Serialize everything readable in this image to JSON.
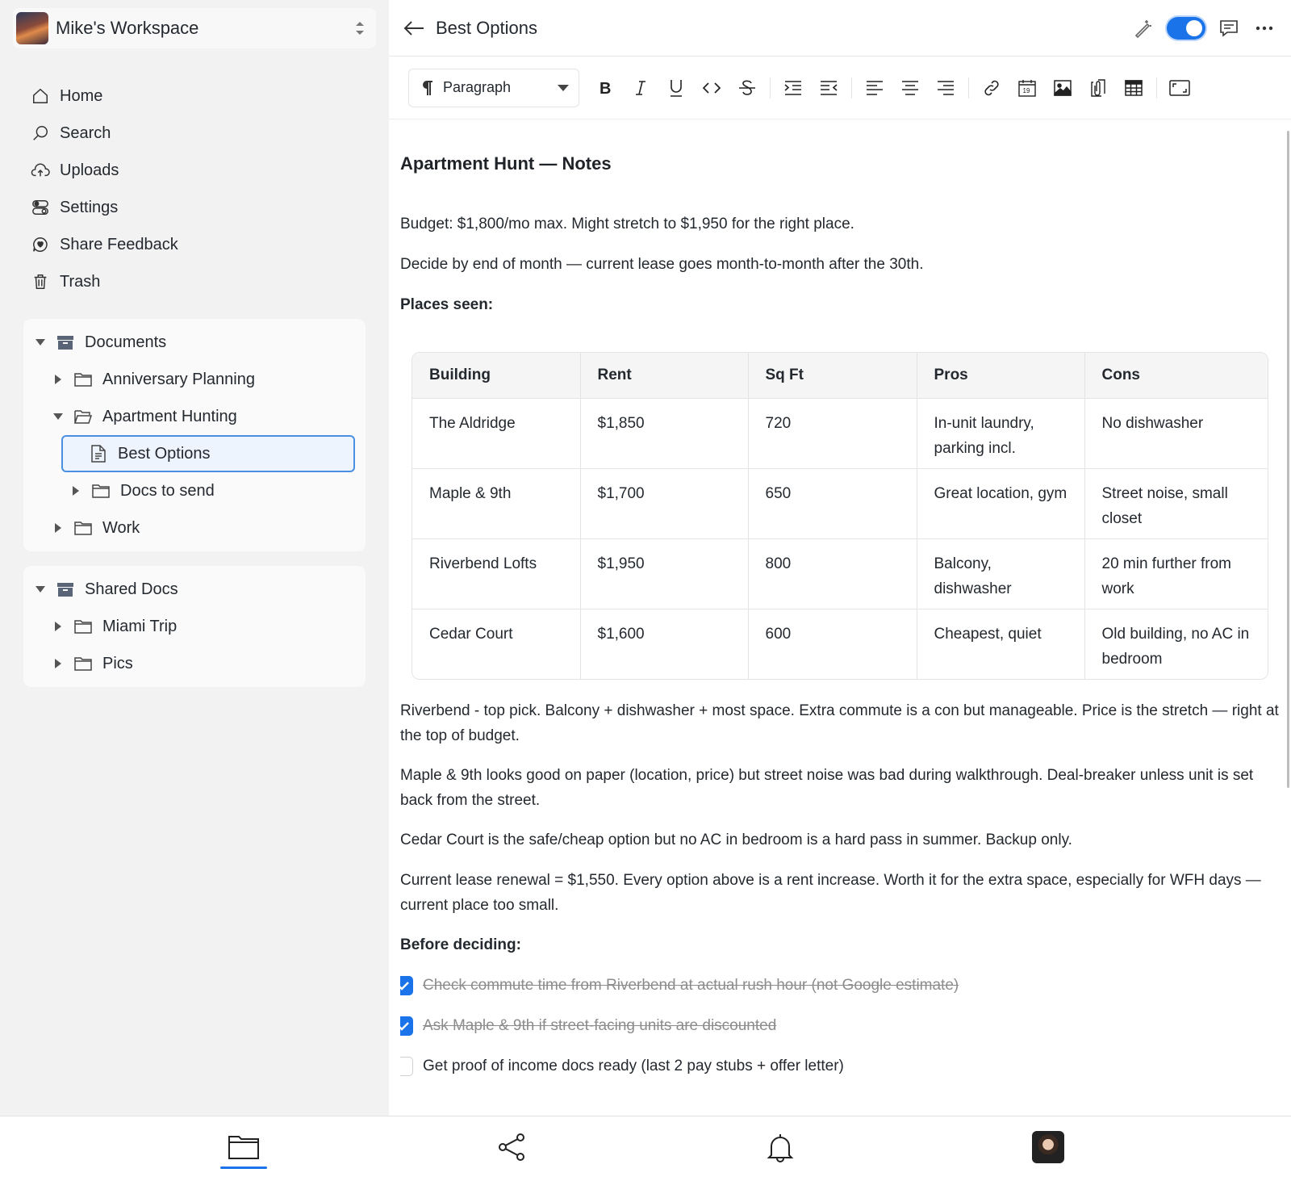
{
  "workspace": {
    "name": "Mike's Workspace"
  },
  "nav": [
    {
      "label": "Home",
      "icon": "home-icon"
    },
    {
      "label": "Search",
      "icon": "search-icon"
    },
    {
      "label": "Uploads",
      "icon": "upload-cloud-icon"
    },
    {
      "label": "Settings",
      "icon": "settings-toggle-icon"
    },
    {
      "label": "Share Feedback",
      "icon": "feedback-icon"
    },
    {
      "label": "Trash",
      "icon": "trash-icon"
    }
  ],
  "documents": {
    "label": "Documents",
    "items": [
      {
        "label": "Anniversary Planning"
      },
      {
        "label": "Apartment Hunting"
      },
      {
        "label": "Best Options"
      },
      {
        "label": "Docs to send"
      },
      {
        "label": "Work"
      }
    ]
  },
  "shared": {
    "label": "Shared Docs",
    "items": [
      {
        "label": "Miami Trip"
      },
      {
        "label": "Pics"
      }
    ]
  },
  "header": {
    "title": "Best Options"
  },
  "toolbar": {
    "block_type": "Paragraph"
  },
  "doc": {
    "title": "Apartment Hunt — Notes",
    "p1": "Budget: $1,800/mo max. Might stretch to $1,950 for the right place.",
    "p2": "Decide by end of month — current lease goes month-to-month after the 30th.",
    "places_heading": "Places seen:",
    "table": {
      "headers": [
        "Building",
        "Rent",
        "Sq Ft",
        "Pros",
        "Cons"
      ],
      "rows": [
        [
          "The Aldridge",
          "$1,850",
          "720",
          "In-unit laundry, parking incl.",
          "No dishwasher"
        ],
        [
          "Maple & 9th",
          "$1,700",
          "650",
          "Great location, gym",
          "Street noise, small closet"
        ],
        [
          "Riverbend Lofts",
          "$1,950",
          "800",
          "Balcony, dishwasher",
          "20 min further from work"
        ],
        [
          "Cedar Court",
          "$1,600",
          "600",
          "Cheapest, quiet",
          "Old building, no AC in bedroom"
        ]
      ]
    },
    "p3": "Riverbend - top pick. Balcony + dishwasher + most space. Extra commute is a con but manageable. Price is the stretch — right at the top of budget.",
    "p4": "Maple & 9th looks good on paper (location, price) but street noise was bad during walkthrough. Deal-breaker unless unit is set back from the street.",
    "p5": "Cedar Court is the safe/cheap option but no AC in bedroom is a hard pass in summer. Backup only.",
    "p6": "Current lease renewal = $1,550. Every option above is a rent increase. Worth it for the extra space, especially for WFH days — current place too small.",
    "todo_heading": "Before deciding:",
    "tasks": [
      {
        "text": "Check commute time from Riverbend at actual rush hour (not Google estimate)",
        "done": true
      },
      {
        "text": "Ask Maple & 9th if street-facing units are discounted",
        "done": true
      },
      {
        "text": "Get proof of income docs ready (last 2 pay stubs + offer letter)",
        "done": false
      }
    ]
  },
  "colors": {
    "accent": "#1a73e8",
    "sidebar_bg": "#f2f2f3",
    "selected_border": "#4a90e2"
  }
}
